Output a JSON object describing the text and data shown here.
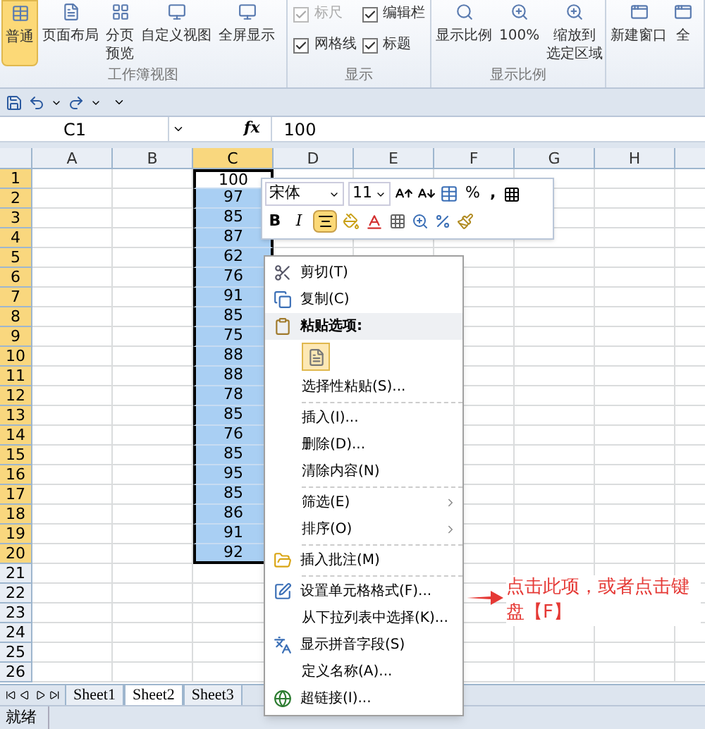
{
  "ribbon": {
    "groups": [
      {
        "label": "工作簿视图",
        "kind": "buttons",
        "buttons": [
          {
            "lines": [
              "普通"
            ],
            "selected": true
          },
          {
            "lines": [
              "页面布局"
            ],
            "selected": false
          },
          {
            "lines": [
              "分页",
              "预览"
            ],
            "selected": false
          },
          {
            "lines": [
              "自定义视图"
            ],
            "selected": false
          },
          {
            "lines": [
              "全屏显示"
            ],
            "selected": false
          }
        ]
      },
      {
        "label": "显示",
        "kind": "checkboxes",
        "checkboxes": [
          {
            "label": "标尺",
            "checked": true,
            "disabled": true
          },
          {
            "label": "编辑栏",
            "checked": true,
            "disabled": false
          },
          {
            "label": "网格线",
            "checked": true,
            "disabled": false
          },
          {
            "label": "标题",
            "checked": true,
            "disabled": false
          }
        ]
      },
      {
        "label": "显示比例",
        "kind": "buttons",
        "buttons": [
          {
            "lines": [
              "显示比例"
            ],
            "selected": false
          },
          {
            "lines": [
              "100%"
            ],
            "selected": false
          },
          {
            "lines": [
              "缩放到",
              "选定区域"
            ],
            "selected": false
          }
        ]
      },
      {
        "kind": "buttons",
        "buttons": [
          {
            "lines": [
              "新建窗口"
            ],
            "selected": false
          },
          {
            "lines": [
              "全"
            ],
            "selected": false
          }
        ]
      }
    ]
  },
  "formula_bar": {
    "name_box": "C1",
    "function_label": "fx",
    "formula": "100"
  },
  "sheet": {
    "columns": [
      {
        "label": "A",
        "selected": false
      },
      {
        "label": "B",
        "selected": false
      },
      {
        "label": "C",
        "selected": true
      },
      {
        "label": "D",
        "selected": false
      },
      {
        "label": "E",
        "selected": false
      },
      {
        "label": "F",
        "selected": false
      },
      {
        "label": "G",
        "selected": false
      },
      {
        "label": "H",
        "selected": false
      }
    ],
    "rows": [
      {
        "label": "1",
        "selected": true,
        "active": true,
        "value": "100"
      },
      {
        "label": "2",
        "selected": true,
        "active": false,
        "value": "97"
      },
      {
        "label": "3",
        "selected": true,
        "active": false,
        "value": "85"
      },
      {
        "label": "4",
        "selected": true,
        "active": false,
        "value": "87"
      },
      {
        "label": "5",
        "selected": true,
        "active": false,
        "value": "62"
      },
      {
        "label": "6",
        "selected": true,
        "active": false,
        "value": "76"
      },
      {
        "label": "7",
        "selected": true,
        "active": false,
        "value": "91"
      },
      {
        "label": "8",
        "selected": true,
        "active": false,
        "value": "85"
      },
      {
        "label": "9",
        "selected": true,
        "active": false,
        "value": "75"
      },
      {
        "label": "10",
        "selected": true,
        "active": false,
        "value": "88"
      },
      {
        "label": "11",
        "selected": true,
        "active": false,
        "value": "88"
      },
      {
        "label": "12",
        "selected": true,
        "active": false,
        "value": "78"
      },
      {
        "label": "13",
        "selected": true,
        "active": false,
        "value": "85"
      },
      {
        "label": "14",
        "selected": true,
        "active": false,
        "value": "76"
      },
      {
        "label": "15",
        "selected": true,
        "active": false,
        "value": "85"
      },
      {
        "label": "16",
        "selected": true,
        "active": false,
        "value": "95"
      },
      {
        "label": "17",
        "selected": true,
        "active": false,
        "value": "85"
      },
      {
        "label": "18",
        "selected": true,
        "active": false,
        "value": "86"
      },
      {
        "label": "19",
        "selected": true,
        "active": false,
        "value": "91"
      },
      {
        "label": "20",
        "selected": true,
        "active": false,
        "value": "92"
      },
      {
        "label": "21",
        "selected": false,
        "active": false
      },
      {
        "label": "22",
        "selected": false,
        "active": false
      },
      {
        "label": "23",
        "selected": false,
        "active": false
      },
      {
        "label": "24",
        "selected": false,
        "active": false
      },
      {
        "label": "25",
        "selected": false,
        "active": false
      },
      {
        "label": "26",
        "selected": false,
        "active": false
      }
    ]
  },
  "mini_toolbar": {
    "font": "宋体",
    "size": "11",
    "bold": "B",
    "italic": "I",
    "percent": "%",
    "comma": ",",
    "align_center_selected": true
  },
  "context_menu": [
    {
      "kind": "item",
      "label": "剪切(T)"
    },
    {
      "kind": "item",
      "label": "复制(C)"
    },
    {
      "kind": "header",
      "label": "粘贴选项:"
    },
    {
      "kind": "paste_option"
    },
    {
      "kind": "item",
      "label": "选择性粘贴(S)..."
    },
    {
      "kind": "separator"
    },
    {
      "kind": "item",
      "label": "插入(I)..."
    },
    {
      "kind": "item",
      "label": "删除(D)..."
    },
    {
      "kind": "item",
      "label": "清除内容(N)"
    },
    {
      "kind": "separator"
    },
    {
      "kind": "submenu",
      "label": "筛选(E)"
    },
    {
      "kind": "submenu",
      "label": "排序(O)"
    },
    {
      "kind": "separator"
    },
    {
      "kind": "item",
      "label": "插入批注(M)"
    },
    {
      "kind": "separator"
    },
    {
      "kind": "item",
      "label": "设置单元格格式(F)..."
    },
    {
      "kind": "item",
      "label": "从下拉列表中选择(K)..."
    },
    {
      "kind": "item",
      "label": "显示拼音字段(S)"
    },
    {
      "kind": "item",
      "label": "定义名称(A)..."
    },
    {
      "kind": "item",
      "label": "超链接(I)..."
    }
  ],
  "annotation": {
    "text": "点击此项，或者点击键盘【F】"
  },
  "sheet_tabs": [
    {
      "label": "Sheet1",
      "selected": false
    },
    {
      "label": "Sheet2",
      "selected": true
    },
    {
      "label": "Sheet3",
      "selected": false
    }
  ],
  "status_bar": {
    "text": "就绪"
  }
}
